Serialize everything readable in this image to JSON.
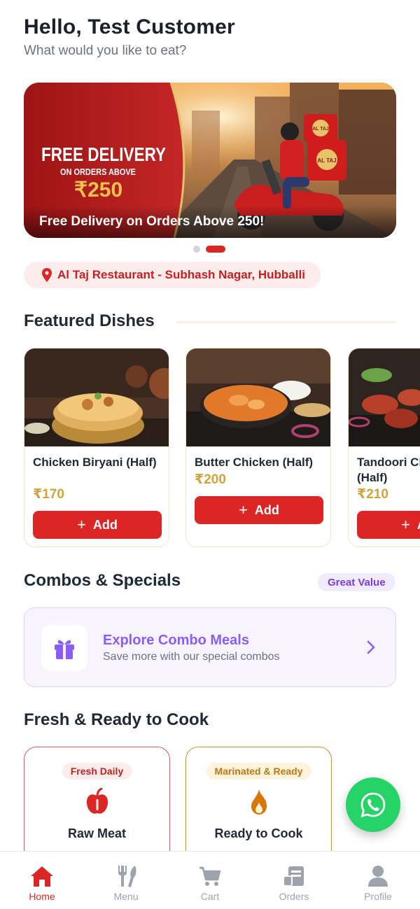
{
  "header": {
    "greeting": "Hello, Test Customer",
    "subtitle": "What would you like to eat?"
  },
  "banner": {
    "headline": "FREE DELIVERY",
    "subline": "ON ORDERS ABOVE",
    "amount": "₹250",
    "bag_logo": "AL TAJ",
    "caption": "Free Delivery on Orders Above 250!",
    "slides": 2,
    "active_slide": 2
  },
  "location": {
    "icon": "map-pin-icon",
    "text": "Al Taj Restaurant - Subhash Nagar, Hubballi"
  },
  "featured": {
    "title": "Featured Dishes",
    "add_label": "Add",
    "items": [
      {
        "name": "Chicken Biryani (Half)",
        "price": "₹170"
      },
      {
        "name": "Butter Chicken (Half)",
        "price": "₹200"
      },
      {
        "name": "Tandoori Chicken (Half)",
        "price": "₹210"
      }
    ]
  },
  "combos": {
    "title": "Combos & Specials",
    "badge": "Great Value",
    "card_title": "Explore Combo Meals",
    "card_subtitle": "Save more with our special combos",
    "icon": "gift-icon"
  },
  "fresh": {
    "title": "Fresh & Ready to Cook",
    "cards": [
      {
        "pill": "Fresh Daily",
        "label": "Raw Meat",
        "icon": "apple-icon",
        "color": "#dc2626"
      },
      {
        "pill": "Marinated & Ready",
        "label": "Ready to Cook",
        "icon": "flame-icon",
        "color": "#d97706"
      }
    ]
  },
  "whatsapp": {
    "icon": "whatsapp-icon",
    "color": "#25d366"
  },
  "tabbar": {
    "items": [
      {
        "label": "Home",
        "icon": "home-icon",
        "active": true
      },
      {
        "label": "Menu",
        "icon": "utensils-icon",
        "active": false
      },
      {
        "label": "Cart",
        "icon": "cart-icon",
        "active": false
      },
      {
        "label": "Orders",
        "icon": "receipt-icon",
        "active": false
      },
      {
        "label": "Profile",
        "icon": "user-icon",
        "active": false
      }
    ]
  },
  "colors": {
    "primary": "#dc2626",
    "gold": "#d4a23a",
    "purple": "#8b5cf6",
    "orange": "#d97706"
  }
}
